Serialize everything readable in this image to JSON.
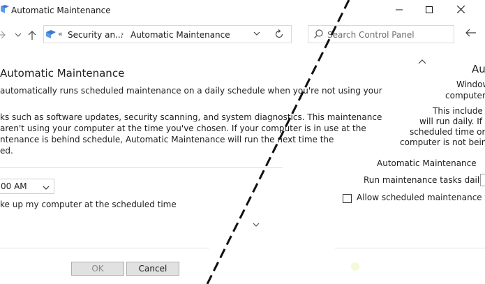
{
  "window": {
    "title": "Automatic Maintenance",
    "icon": "control-panel-icon"
  },
  "titlebar_buttons": {
    "minimize": "minimize-icon",
    "maximize": "maximize-icon",
    "close": "close-icon"
  },
  "nav": {
    "breadcrumbs": [
      "Security an...",
      "Automatic Maintenance"
    ],
    "search_placeholder": "Search Control Panel"
  },
  "main": {
    "heading": "Automatic Maintenance",
    "paragraph1": [
      "automatically runs scheduled maintenance on a daily schedule when you're not using your"
    ],
    "paragraph2": [
      "ks such as software updates, security scanning, and system diagnostics. This maintenance",
      "aren't using your computer at the time you've chosen. If your computer is in use at the",
      "ntenance is behind schedule, Automatic Maintenance will run the next time the",
      "ed."
    ],
    "time_value": "00 AM",
    "wake_label": "ke up my computer at the scheduled time",
    "ok_label": "OK",
    "cancel_label": "Cancel"
  },
  "right_window": {
    "title": "Au",
    "lines": [
      "Window",
      "computer i",
      "This include",
      "will run daily. If yo",
      "scheduled time or m",
      "computer is not being u"
    ],
    "section_label": "Automatic Maintenance",
    "run_label": "Run maintenance tasks daily at",
    "allow_label": "Allow scheduled maintenance to w"
  }
}
